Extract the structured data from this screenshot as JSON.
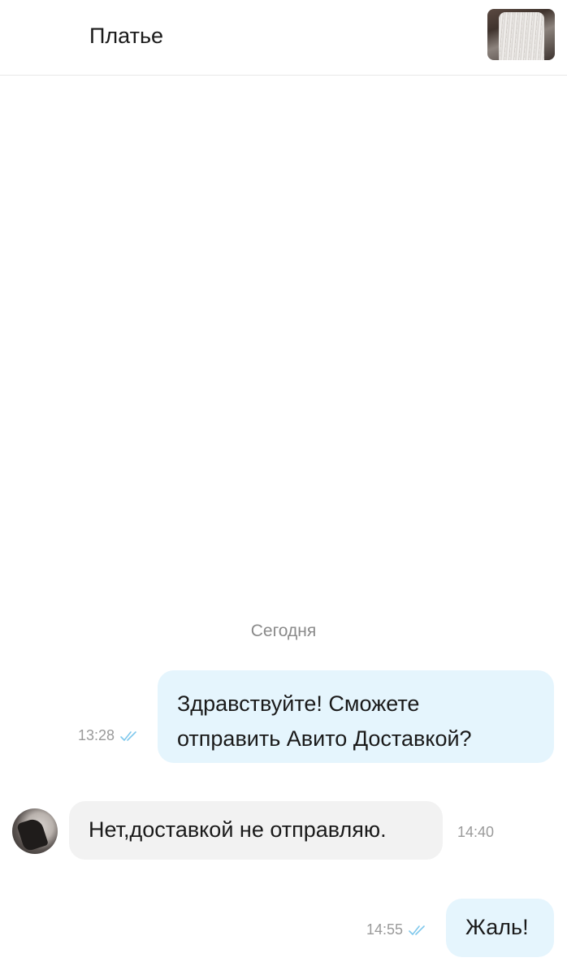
{
  "header": {
    "title": "Платье",
    "thumbnail_icon": "dress-thumbnail"
  },
  "chat": {
    "date_separator": "Сегодня",
    "messages": [
      {
        "direction": "outgoing",
        "lines": [
          "Здравствуйте! Сможете",
          "отправить Авито Доставкой?"
        ],
        "time": "13:28",
        "status": "read"
      },
      {
        "direction": "incoming",
        "lines": [
          "Нет,доставкой не отправляю."
        ],
        "time": "14:40"
      },
      {
        "direction": "outgoing",
        "lines": [
          "Жаль!"
        ],
        "time": "14:55",
        "status": "read"
      }
    ]
  },
  "colors": {
    "outgoing_bubble": "#e5f5fd",
    "incoming_bubble": "#f2f2f2",
    "read_check": "#7fc8ec",
    "meta_text": "#9a9a9a"
  }
}
